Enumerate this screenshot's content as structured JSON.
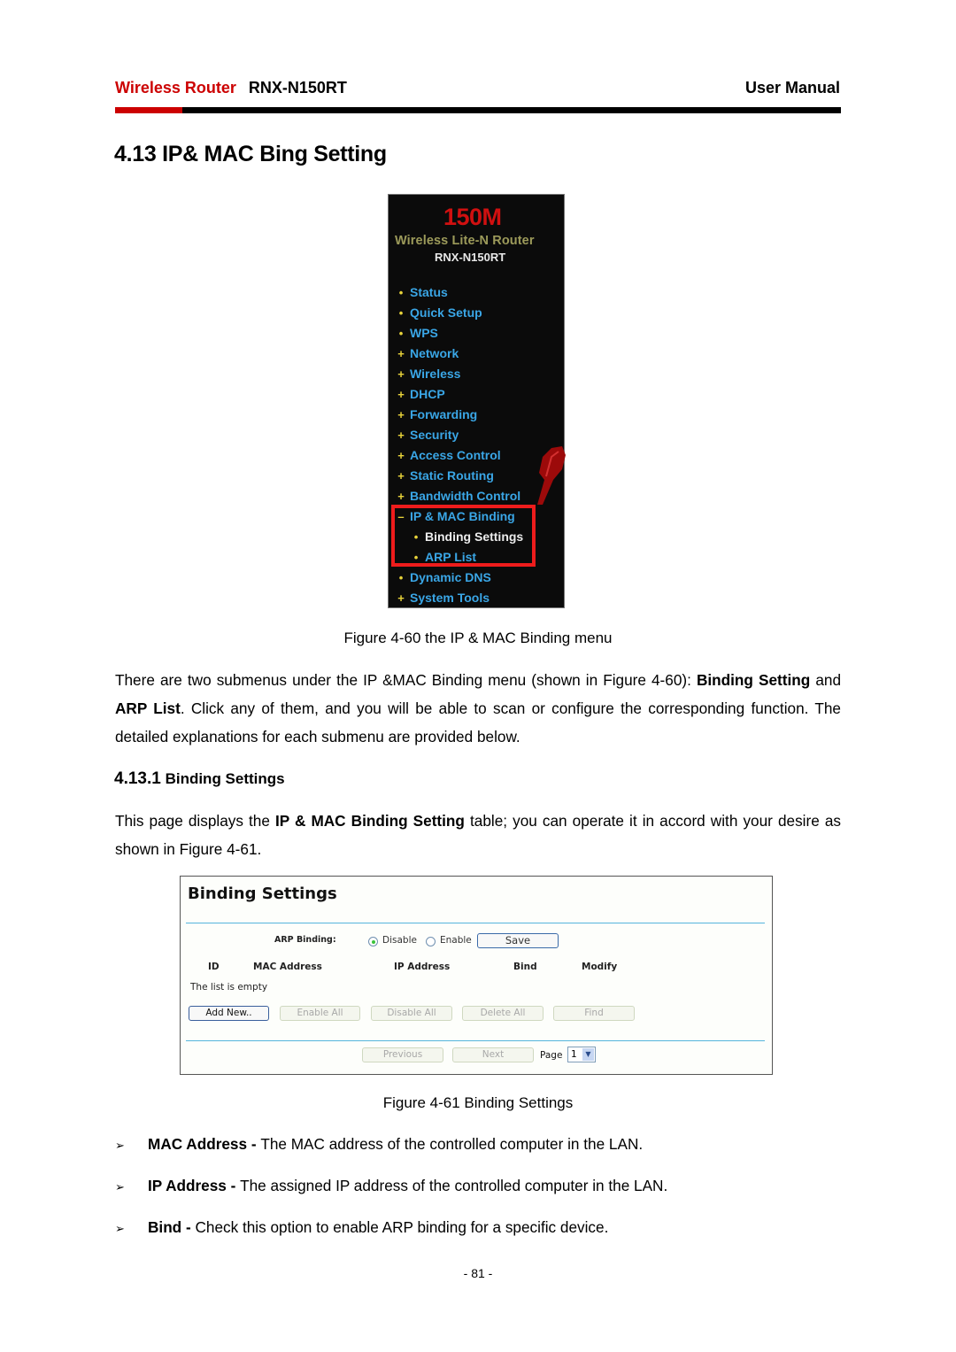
{
  "header": {
    "brand": "Wireless Router",
    "model": "RNX-N150RT",
    "doc_type": "User Manual",
    "accent_color": "#cc0000"
  },
  "section": {
    "title": "4.13 IP& MAC Bing Setting"
  },
  "router_menu": {
    "speed": "150M",
    "product_line": "Wireless Lite-N Router",
    "model": "RNX-N150RT",
    "items": [
      {
        "label": "Status",
        "bullet": "dot"
      },
      {
        "label": "Quick Setup",
        "bullet": "dot"
      },
      {
        "label": "WPS",
        "bullet": "dot"
      },
      {
        "label": "Network",
        "bullet": "plus"
      },
      {
        "label": "Wireless",
        "bullet": "plus"
      },
      {
        "label": "DHCP",
        "bullet": "plus"
      },
      {
        "label": "Forwarding",
        "bullet": "plus"
      },
      {
        "label": "Security",
        "bullet": "plus"
      },
      {
        "label": "Access Control",
        "bullet": "plus"
      },
      {
        "label": "Static Routing",
        "bullet": "plus"
      },
      {
        "label": "Bandwidth Control",
        "bullet": "plus"
      },
      {
        "label": "IP & MAC Binding",
        "bullet": "minus"
      },
      {
        "label": "Binding Settings",
        "bullet": "dot",
        "sub": true
      },
      {
        "label": "ARP List",
        "bullet": "dot",
        "sub": true
      },
      {
        "label": "Dynamic DNS",
        "bullet": "dot"
      },
      {
        "label": "System Tools",
        "bullet": "plus"
      }
    ],
    "highlight_color": "#ee1c1c"
  },
  "figure_60_caption": "Figure 4-60 the IP & MAC Binding menu",
  "intro_paragraph": {
    "t1": "There are two submenus under the IP &MAC Binding menu (shown in Figure 4-60): ",
    "b1": "Binding Setting",
    "t2": " and ",
    "b2": "ARP List",
    "t3": ". Click any of them, and you will be able to scan or configure the corresponding function. The detailed explanations for each submenu are provided below."
  },
  "subsection": {
    "number": "4.13.1",
    "title": "Binding Settings"
  },
  "subsection_paragraph": {
    "t1": "This page displays the ",
    "b1": "IP & MAC Binding Setting",
    "t2": " table; you can operate it in accord with your desire as shown in Figure 4-61."
  },
  "binding_screen": {
    "title": "Binding Settings",
    "arp_binding_label": "ARP Binding:",
    "options": [
      "Disable",
      "Enable"
    ],
    "selected_option": "Disable",
    "save_label": "Save",
    "columns": [
      "ID",
      "MAC Address",
      "IP Address",
      "Bind",
      "Modify"
    ],
    "empty_text": "The list is empty",
    "buttons": [
      "Add New..",
      "Enable All",
      "Disable All",
      "Delete All",
      "Find"
    ],
    "previous_label": "Previous",
    "next_label": "Next",
    "page_label": "Page",
    "page_value": "1"
  },
  "figure_61_caption": "Figure 4-61 Binding Settings",
  "bullets": [
    {
      "term": "MAC Address - ",
      "text": "The MAC address of the controlled computer in the LAN."
    },
    {
      "term": "IP Address - ",
      "text": "The assigned IP address of the controlled computer in the LAN."
    },
    {
      "term": "Bind - ",
      "text": "Check this option to enable ARP binding for a specific device."
    }
  ],
  "page_number": "- 81 -"
}
